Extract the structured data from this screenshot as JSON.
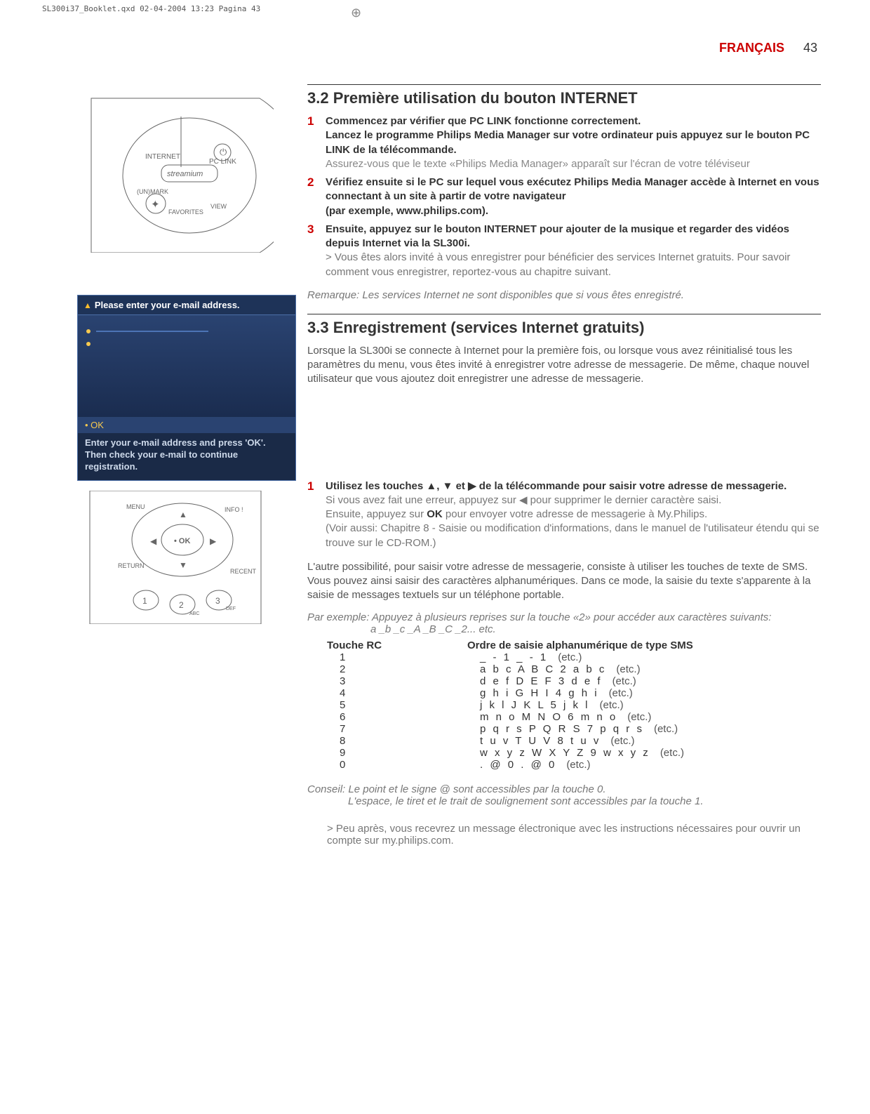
{
  "doc_header_note": "SL300i37_Booklet.qxd  02-04-2004  13:23  Pagina 43",
  "lang_label": "FRANÇAIS",
  "page_number": "43",
  "tv": {
    "top": "Please enter your e-mail address.",
    "ok": "• OK",
    "bot_line1": "Enter your e-mail address and press 'OK'.",
    "bot_line2": "Then check your e-mail to continue registration."
  },
  "sec32": {
    "title": "3.2 Première utilisation du bouton INTERNET",
    "s1_num": "1",
    "s1_bold": "Commencez par vérifier que PC LINK fonctionne correctement.",
    "s1_plain1": "Lancez le programme Philips Media Manager sur votre ordinateur puis appuyez sur le bouton PC LINK de la télécommande.",
    "s1_light": "Assurez-vous que le texte «Philips Media Manager» apparaît sur l'écran de votre téléviseur",
    "s2_num": "2",
    "s2_bold": "Vérifiez ensuite si le PC sur lequel vous exécutez Philips Media Manager accède à Internet en vous connectant à un site à partir de votre navigateur",
    "s2_plain": "(par exemple, www.philips.com).",
    "s3_num": "3",
    "s3_bold": "Ensuite, appuyez sur le bouton INTERNET pour ajouter de la musique et regarder des vidéos depuis Internet via la SL300i.",
    "s3_gt": "> Vous êtes alors invité à vous enregistrer pour bénéficier des services Internet gratuits. Pour savoir comment vous enregistrer, reportez-vous au chapitre suivant.",
    "remark": "Remarque: Les services Internet ne sont disponibles que si vous êtes enregistré."
  },
  "sec33": {
    "title": "3.3 Enregistrement (services Internet gratuits)",
    "intro": "Lorsque la SL300i se connecte à Internet pour la première fois, ou lorsque vous avez réinitialisé tous les paramètres du menu, vous êtes invité à enregistrer votre adresse de messagerie. De même, chaque nouvel utilisateur que vous ajoutez doit enregistrer une adresse de messagerie.",
    "s1_num": "1",
    "s1_bold": "Utilisez les touches ▲, ▼ et ▶ de la télécommande pour saisir votre adresse de messagerie.",
    "s1_l1": "Si vous avez fait une erreur, appuyez sur ◀ pour supprimer le dernier caractère saisi.",
    "s1_l2a": "Ensuite, appuyez sur ",
    "s1_l2_ok": "OK",
    "s1_l2b": " pour envoyer votre adresse de messagerie à My.Philips.",
    "s1_l3": "(Voir aussi: Chapitre 8 - Saisie ou modification d'informations, dans le manuel de l'utilisateur étendu qui se trouve sur le CD-ROM.)",
    "para2": "L'autre possibilité, pour saisir votre adresse de messagerie, consiste à utiliser les touches de texte de SMS. Vous pouvez ainsi saisir des caractères alphanumériques. Dans ce mode, la saisie du texte s'apparente à la saisie de messages textuels sur un téléphone portable.",
    "example_label": "Par exemple:",
    "example_text": "Appuyez à plusieurs reprises sur la touche «2» pour accéder aux caractères suivants:",
    "example_line2": "a _b _c _A _B _C _2... etc.",
    "th_left": "Touche RC",
    "th_right": "Ordre de saisie alphanumérique de type SMS",
    "rows": [
      {
        "k": "1",
        "v": "_ - 1 _ - 1",
        "etc": "(etc.)"
      },
      {
        "k": "2",
        "v": "a b c A B C 2 a b c",
        "etc": "(etc.)"
      },
      {
        "k": "3",
        "v": "d e f D E F 3 d e f",
        "etc": "(etc.)"
      },
      {
        "k": "4",
        "v": "g h i G H I 4 g h i",
        "etc": "(etc.)"
      },
      {
        "k": "5",
        "v": "j k l J K L 5 j k l",
        "etc": "(etc.)"
      },
      {
        "k": "6",
        "v": "m n o M N O 6 m n o",
        "etc": "(etc.)"
      },
      {
        "k": "7",
        "v": "p q r s P Q R S 7 p q r s",
        "etc": "(etc.)"
      },
      {
        "k": "8",
        "v": "t u v T U V 8 t u v",
        "etc": "(etc.)"
      },
      {
        "k": "9",
        "v": "w x y z W X Y Z 9 w x y z",
        "etc": "(etc.)"
      },
      {
        "k": "0",
        "v": ". @ 0 . @ 0",
        "etc": "(etc.)"
      }
    ],
    "tip_label": "Conseil:",
    "tip_l1": "Le point et le signe @ sont accessibles par la touche 0.",
    "tip_l2": "L'espace, le tiret et le trait de soulignement sont accessibles par la touche 1.",
    "after": "> Peu après, vous recevrez un message électronique avec les instructions nécessaires pour ouvrir un compte sur my.philips.com."
  }
}
